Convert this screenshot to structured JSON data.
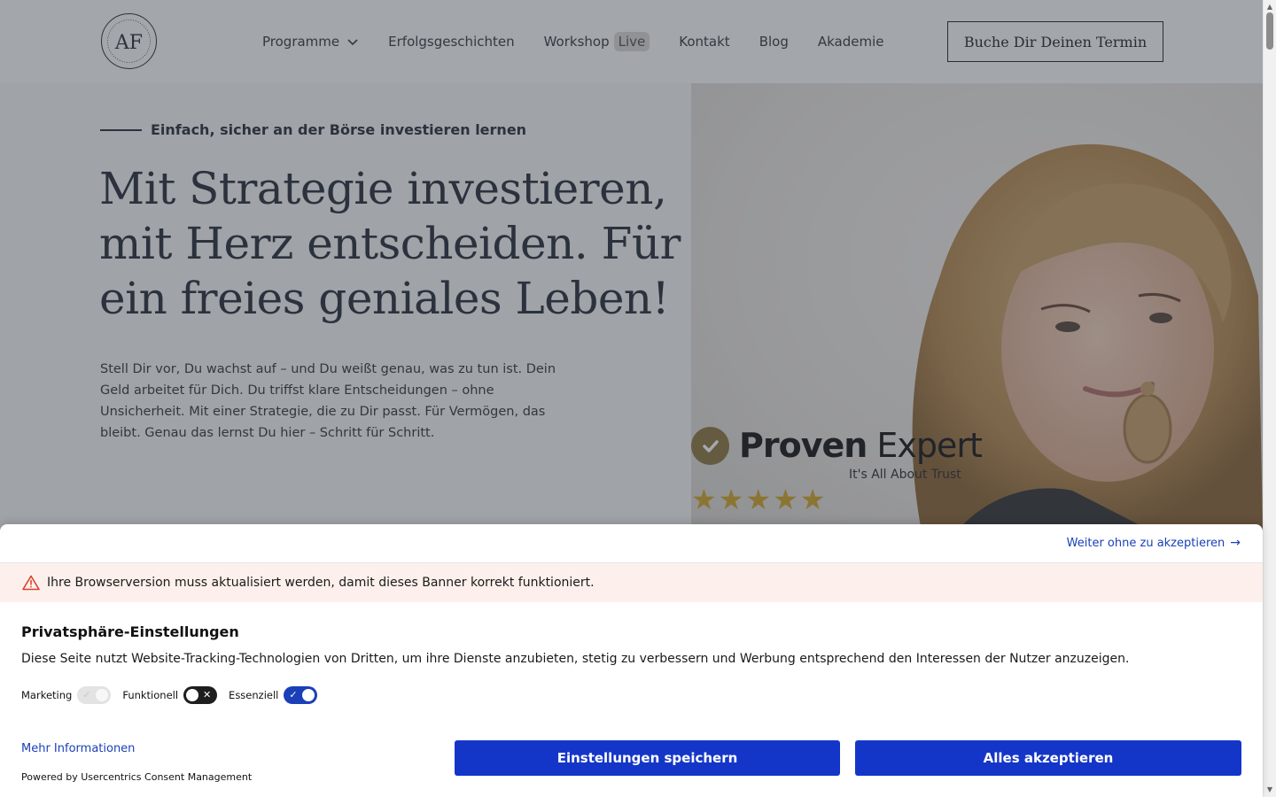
{
  "header": {
    "logo_text": "AF",
    "nav": [
      {
        "label": "Programme",
        "has_dropdown": true
      },
      {
        "label": "Erfolgsgeschichten"
      },
      {
        "label": "Workshop",
        "badge": "Live"
      },
      {
        "label": "Kontakt"
      },
      {
        "label": "Blog"
      },
      {
        "label": "Akademie"
      }
    ],
    "cta_label": "Buche Dir Deinen Termin"
  },
  "hero": {
    "eyebrow": "Einfach, sicher an der Börse investieren lernen",
    "headline_lines": [
      "Mit Strategie investieren,",
      "mit Herz entscheiden. Für",
      "ein freies geniales Leben!"
    ],
    "lead": "Stell Dir vor, Du wachst auf – und Du weißt genau, was zu tun ist. Dein Geld arbeitet für Dich. Du triffst klare Entscheidungen – ohne Unsicherheit. Mit einer Strategie, die zu Dir passt. Für Vermögen, das bleibt. Genau das lernst Du hier – Schritt für Schritt.",
    "proven_expert": {
      "word_bold": "Proven",
      "word_regular": " Expert",
      "tagline": "It's All About Trust",
      "rating": 5
    }
  },
  "consent": {
    "skip_link": "Weiter ohne zu akzeptieren",
    "warning": "Ihre Browserversion muss aktualisiert werden, damit dieses Banner korrekt funktioniert.",
    "title": "Privatsphäre-Einstellungen",
    "description": "Diese Seite nutzt Website-Tracking-Technologien von Dritten, um ihre Dienste anzubieten, stetig zu verbessern und Werbung entsprechend den Interessen der Nutzer anzuzeigen.",
    "toggles": [
      {
        "label": "Marketing",
        "state": "disabled-on"
      },
      {
        "label": "Funktionell",
        "state": "off"
      },
      {
        "label": "Essenziell",
        "state": "on"
      }
    ],
    "more_info": "Mehr Informationen",
    "powered_by": "Powered by Usercentrics Consent Management",
    "save_label": "Einstellungen speichern",
    "accept_label": "Alles akzeptieren"
  },
  "colors": {
    "accent": "#1436c8",
    "link": "#1a3fb8",
    "warning_bg": "#fdf0ec",
    "star": "#d1a72e"
  }
}
